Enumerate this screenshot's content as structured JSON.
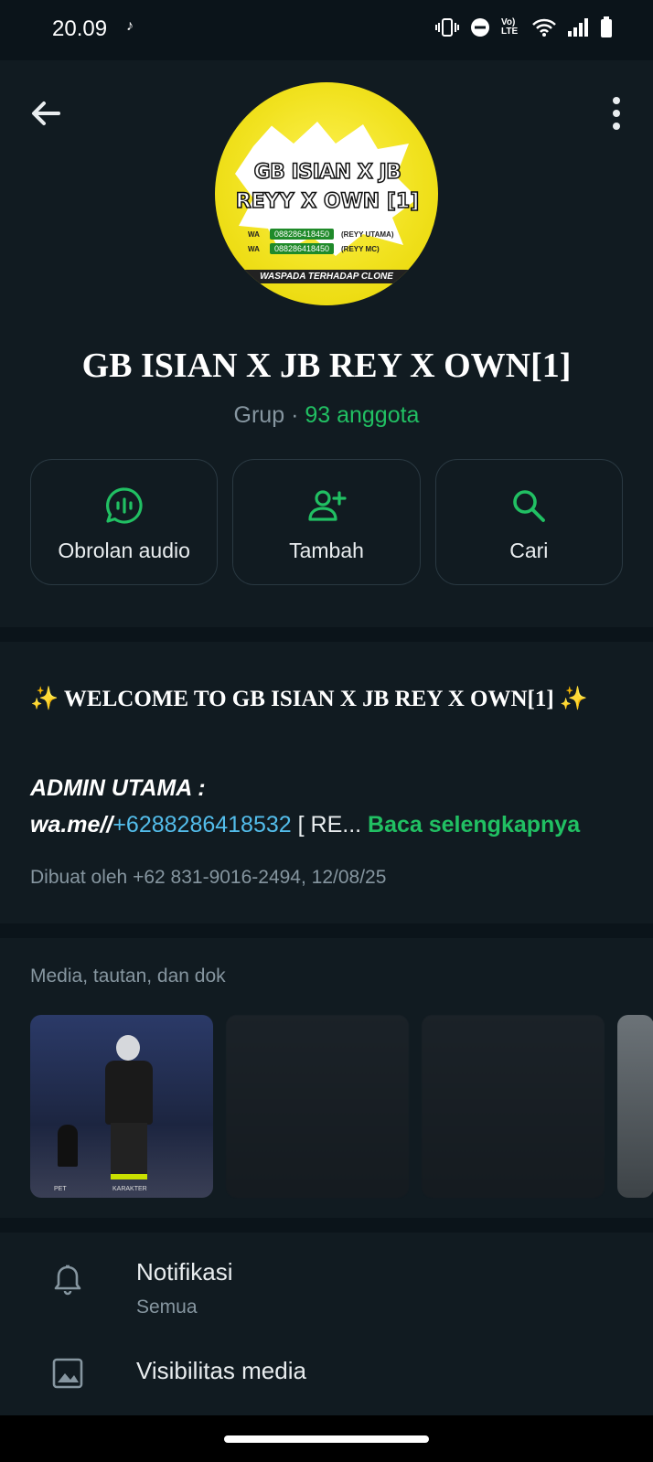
{
  "status_bar": {
    "time": "20.09",
    "icons": [
      "tiktok-icon",
      "vibrate-icon",
      "dnd-icon",
      "volte-icon",
      "wifi-icon",
      "signal-icon",
      "battery-icon"
    ],
    "volte_label": "Vo) LTE"
  },
  "header": {
    "avatar": {
      "line1": "GB ISIAN X JB",
      "line2": "REYY X OWN [1]",
      "phone1": "088286418450",
      "phone2": "088286418450",
      "side1": "(REYY UTAMA)",
      "side2": "(REYY MC)",
      "wa1": "WA",
      "wa2": "WA",
      "footer": "WASPADA TERHADAP CLONE"
    },
    "group_name": "GB ISIAN X JB REY X OWN[1]",
    "type_label": "Grup",
    "separator": " · ",
    "member_count": "93 anggota"
  },
  "actions": [
    {
      "label": "Obrolan audio",
      "icon": "audio-chat-icon"
    },
    {
      "label": "Tambah",
      "icon": "add-person-icon"
    },
    {
      "label": "Cari",
      "icon": "search-icon"
    }
  ],
  "description": {
    "welcome_line": "✨ WELCOME TO GB ISIAN X JB REY X OWN[1] ✨",
    "admin_label": "ADMIN UTAMA :",
    "wa_prefix": "wa.me//",
    "phone_link": "+6288286418532",
    "rest": " [ RE...",
    "read_more": " Baca selengkapnya",
    "created_by": "Dibuat oleh +62 831-9016-2494, 12/08/25"
  },
  "media": {
    "title": "Media, tautan, dan dok",
    "thumb1_hud_left": "PET",
    "thumb1_hud_right": "KARAKTER"
  },
  "settings": [
    {
      "title": "Notifikasi",
      "subtitle": "Semua",
      "icon": "bell-icon"
    },
    {
      "title": "Visibilitas media",
      "icon": "image-icon"
    }
  ],
  "colors": {
    "accent": "#21c063",
    "link": "#53bdeb",
    "background": "#0b141a",
    "surface": "#111b21"
  }
}
